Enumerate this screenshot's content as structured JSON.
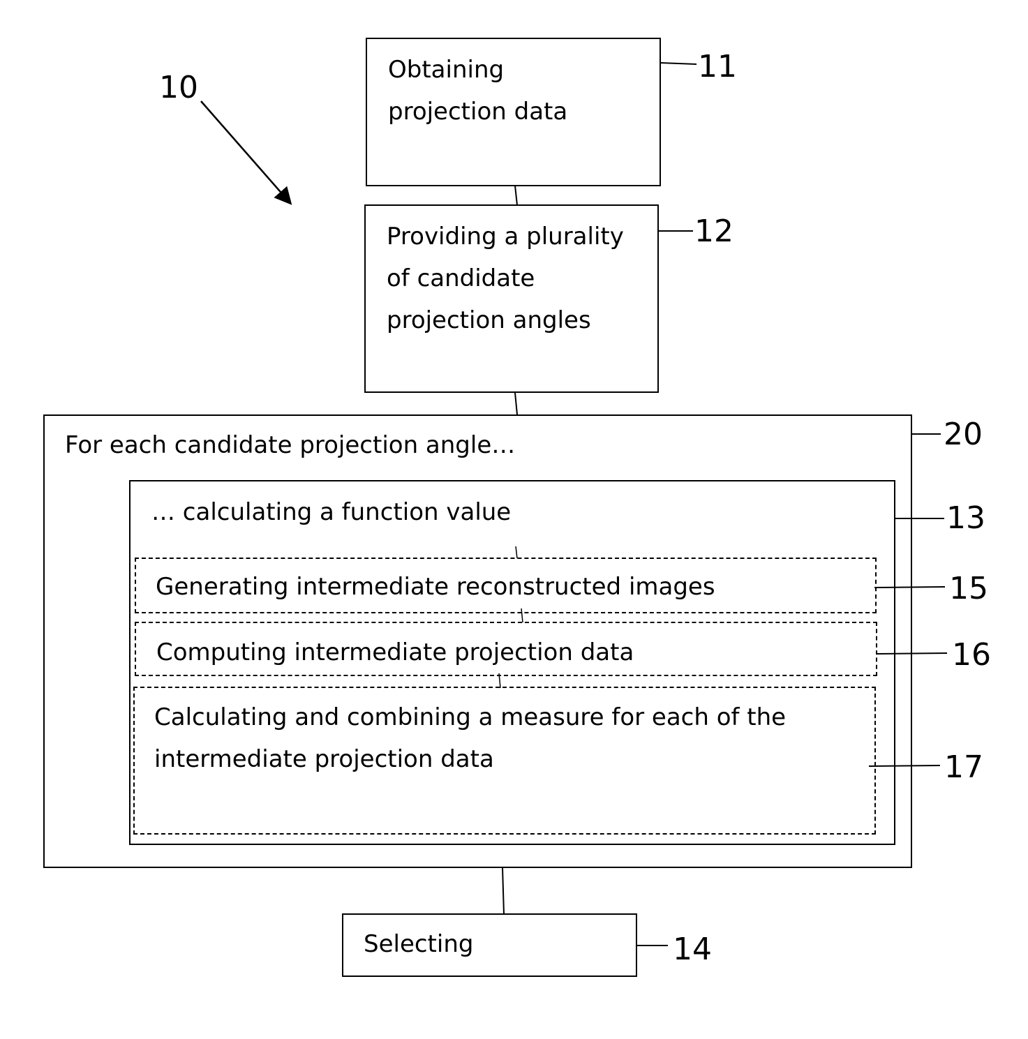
{
  "figure_ref": "10",
  "steps": {
    "s11": {
      "ref": "11",
      "lines": [
        "Obtaining",
        "projection data"
      ]
    },
    "s12": {
      "ref": "12",
      "lines": [
        "Providing a plurality",
        "of candidate",
        "projection angles"
      ]
    },
    "s20": {
      "ref": "20",
      "text": "For each candidate projection angle…"
    },
    "s13": {
      "ref": "13",
      "text": "… calculating a function value"
    },
    "s15": {
      "ref": "15",
      "text": "Generating intermediate reconstructed images"
    },
    "s16": {
      "ref": "16",
      "text": "Computing intermediate projection data"
    },
    "s17": {
      "ref": "17",
      "lines": [
        "Calculating and combining a measure for each of the",
        "intermediate projection data"
      ]
    },
    "s14": {
      "ref": "14",
      "text": "Selecting"
    }
  }
}
